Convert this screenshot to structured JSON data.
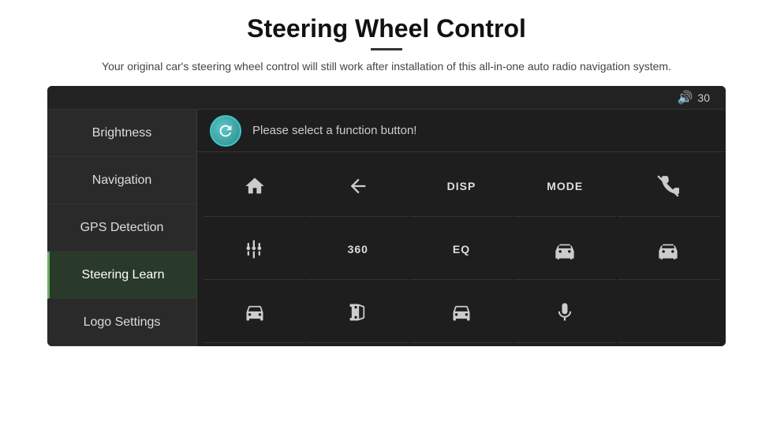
{
  "header": {
    "title": "Steering Wheel Control",
    "subtitle": "Your original car's steering wheel control will still work after installation of this all-in-one auto radio navigation system."
  },
  "topbar": {
    "volume_icon": "🔊",
    "volume_value": "30"
  },
  "sidebar": {
    "items": [
      {
        "id": "brightness",
        "label": "Brightness",
        "active": false
      },
      {
        "id": "navigation",
        "label": "Navigation",
        "active": false
      },
      {
        "id": "gps-detection",
        "label": "GPS Detection",
        "active": false
      },
      {
        "id": "steering-learn",
        "label": "Steering Learn",
        "active": true
      },
      {
        "id": "logo-settings",
        "label": "Logo Settings",
        "active": false
      }
    ]
  },
  "prompt": {
    "text": "Please select a function button!"
  },
  "grid": {
    "rows": 3,
    "cols": 5,
    "cells": [
      {
        "row": 0,
        "col": 0,
        "type": "icon",
        "icon": "home"
      },
      {
        "row": 0,
        "col": 1,
        "type": "icon",
        "icon": "back"
      },
      {
        "row": 0,
        "col": 2,
        "type": "label",
        "label": "DISP"
      },
      {
        "row": 0,
        "col": 3,
        "type": "label",
        "label": "MODE"
      },
      {
        "row": 0,
        "col": 4,
        "type": "icon",
        "icon": "phone-off"
      },
      {
        "row": 1,
        "col": 0,
        "type": "icon",
        "icon": "eq-sliders"
      },
      {
        "row": 1,
        "col": 1,
        "type": "label",
        "label": "360"
      },
      {
        "row": 1,
        "col": 2,
        "type": "label",
        "label": "EQ"
      },
      {
        "row": 1,
        "col": 3,
        "type": "icon",
        "icon": "car-front"
      },
      {
        "row": 1,
        "col": 4,
        "type": "icon",
        "icon": "car-back"
      },
      {
        "row": 2,
        "col": 0,
        "type": "icon",
        "icon": "car-top"
      },
      {
        "row": 2,
        "col": 1,
        "type": "icon",
        "icon": "car-side"
      },
      {
        "row": 2,
        "col": 2,
        "type": "icon",
        "icon": "car-top2"
      },
      {
        "row": 2,
        "col": 3,
        "type": "icon",
        "icon": "mic"
      },
      {
        "row": 2,
        "col": 4,
        "type": "empty"
      }
    ]
  }
}
